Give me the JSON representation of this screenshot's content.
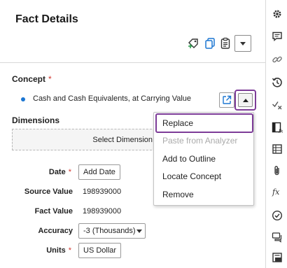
{
  "panel": {
    "title": "Fact Details"
  },
  "concept": {
    "label": "Concept",
    "required_mark": "*",
    "value": "Cash and Cash Equivalents, at Carrying Value"
  },
  "dimensions": {
    "label": "Dimensions",
    "button": "Select Dimension"
  },
  "fields": {
    "date_label": "Date",
    "date_button": "Add Date",
    "source_value_label": "Source Value",
    "source_value": "198939000",
    "fact_value_label": "Fact Value",
    "fact_value": "198939000",
    "accuracy_label": "Accuracy",
    "accuracy_value": "-3 (Thousands)",
    "units_label": "Units",
    "units_value": "US Dollar",
    "required_mark": "*"
  },
  "menu": {
    "items": [
      {
        "label": "Replace",
        "disabled": false,
        "highlighted": true
      },
      {
        "label": "Paste from Analyzer",
        "disabled": true
      },
      {
        "label": "Add to Outline",
        "disabled": false
      },
      {
        "label": "Locate Concept",
        "disabled": false
      },
      {
        "label": "Remove",
        "disabled": false
      }
    ]
  },
  "toolbar": {
    "icons": [
      "gear-icon",
      "comment-icon",
      "link-icon",
      "history-icon",
      "check-x-icon",
      "fx-table-icon",
      "table-icon",
      "paperclip-icon",
      "function-icon",
      "check-circle-icon",
      "comments-icon",
      "panel-icon"
    ]
  },
  "colors": {
    "highlight_border": "#7d3c98",
    "required": "#d0342c",
    "bullet": "#1b76d2",
    "disabled_text": "#aaaaaa"
  }
}
